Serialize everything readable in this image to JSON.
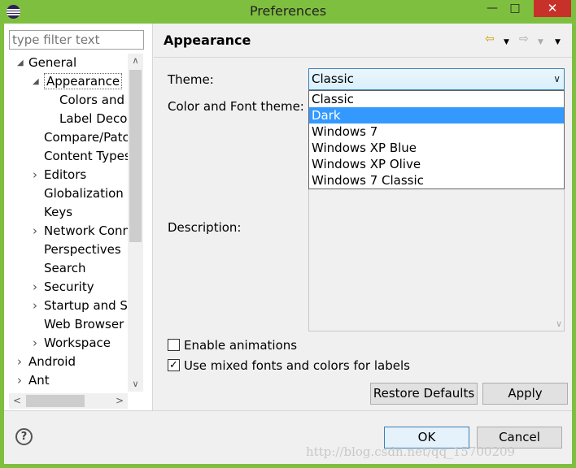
{
  "window": {
    "title": "Preferences",
    "minimize": "—",
    "maximize": "□",
    "close": "✕"
  },
  "filter": {
    "placeholder": "type filter text"
  },
  "tree": [
    {
      "label": "General",
      "level": 0,
      "twisty": "expanded"
    },
    {
      "label": "Appearance",
      "level": 1,
      "twisty": "expanded",
      "selected": true
    },
    {
      "label": "Colors and",
      "level": 2,
      "twisty": "none"
    },
    {
      "label": "Label Decor",
      "level": 2,
      "twisty": "none"
    },
    {
      "label": "Compare/Patc",
      "level": 1,
      "twisty": "none"
    },
    {
      "label": "Content Types",
      "level": 1,
      "twisty": "none"
    },
    {
      "label": "Editors",
      "level": 1,
      "twisty": "collapsed"
    },
    {
      "label": "Globalization",
      "level": 1,
      "twisty": "none"
    },
    {
      "label": "Keys",
      "level": 1,
      "twisty": "none"
    },
    {
      "label": "Network Conn",
      "level": 1,
      "twisty": "collapsed"
    },
    {
      "label": "Perspectives",
      "level": 1,
      "twisty": "none"
    },
    {
      "label": "Search",
      "level": 1,
      "twisty": "none"
    },
    {
      "label": "Security",
      "level": 1,
      "twisty": "collapsed"
    },
    {
      "label": "Startup and Sh",
      "level": 1,
      "twisty": "collapsed"
    },
    {
      "label": "Web Browser",
      "level": 1,
      "twisty": "none"
    },
    {
      "label": "Workspace",
      "level": 1,
      "twisty": "collapsed"
    },
    {
      "label": "Android",
      "level": 0,
      "twisty": "collapsed"
    },
    {
      "label": "Ant",
      "level": 0,
      "twisty": "collapsed"
    }
  ],
  "page": {
    "title": "Appearance",
    "back_icon": "⇦",
    "forward_icon": "⇨",
    "menu_icon": "▼"
  },
  "form": {
    "theme_label": "Theme:",
    "theme_value": "Classic",
    "color_font_label": "Color and Font theme:",
    "description_label": "Description:",
    "theme_options": [
      "Classic",
      "Dark",
      "Windows 7",
      "Windows XP Blue",
      "Windows XP Olive",
      "Windows 7 Classic"
    ],
    "highlighted_option": "Dark",
    "enable_animations_label": "Enable animations",
    "enable_animations_checked": false,
    "mixed_fonts_label": "Use mixed fonts and colors for labels",
    "mixed_fonts_checked": true
  },
  "buttons": {
    "restore_defaults": "Restore Defaults",
    "apply": "Apply",
    "ok": "OK",
    "cancel": "Cancel",
    "help": "?"
  },
  "watermark": "http://blog.csdn.net/qq_15700209",
  "colors": {
    "frame": "#7fbf3f",
    "close_button": "#c7312a",
    "selection": "#3399ff"
  }
}
